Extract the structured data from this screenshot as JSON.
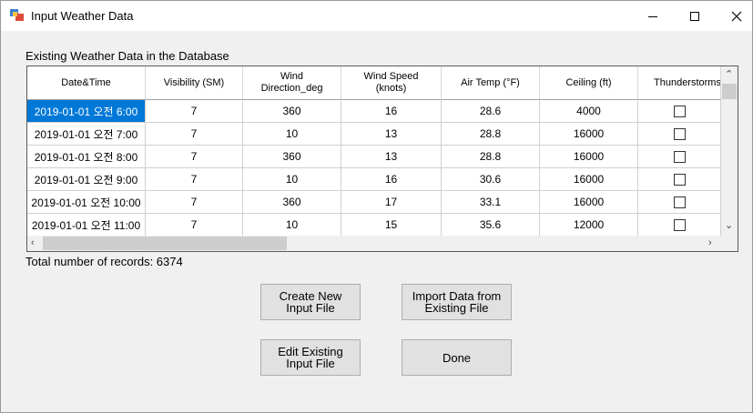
{
  "window": {
    "title": "Input Weather Data"
  },
  "section_label": "Existing Weather Data in the Database",
  "table": {
    "columns": [
      "Date&Time",
      "Visibility (SM)",
      "Wind\nDirection_deg",
      "Wind Speed\n(knots)",
      "Air Temp (°F)",
      "Ceiling (ft)",
      "Thunderstorms"
    ],
    "rows": [
      [
        "2019-01-01 오전 6:00",
        "7",
        "360",
        "16",
        "28.6",
        "4000"
      ],
      [
        "2019-01-01 오전 7:00",
        "7",
        "10",
        "13",
        "28.8",
        "16000"
      ],
      [
        "2019-01-01 오전 8:00",
        "7",
        "360",
        "13",
        "28.8",
        "16000"
      ],
      [
        "2019-01-01 오전 9:00",
        "7",
        "10",
        "16",
        "30.6",
        "16000"
      ],
      [
        "2019-01-01 오전 10:00",
        "7",
        "360",
        "17",
        "33.1",
        "16000"
      ],
      [
        "2019-01-01 오전 11:00",
        "7",
        "10",
        "15",
        "35.6",
        "12000"
      ]
    ],
    "thunderstorms": [
      false,
      false,
      false,
      false,
      false,
      false
    ],
    "selected_row": 0
  },
  "total_records": "Total number of records: 6374",
  "buttons": {
    "create": "Create New\nInput File",
    "import": "Import Data from\nExisting File",
    "edit": "Edit Existing\nInput File",
    "done": "Done"
  }
}
